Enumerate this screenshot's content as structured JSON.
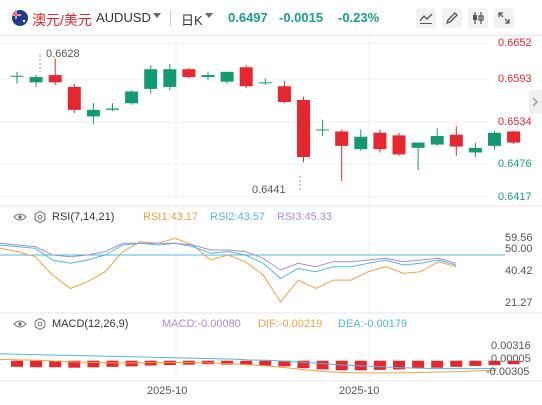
{
  "header": {
    "symbol_name": "澳元/美元",
    "symbol_code": "AUDUSD",
    "period": "日K",
    "last_price": "0.6497",
    "change": "-0.0015",
    "change_pct": "-0.23%",
    "tools": [
      "line-tool-icon",
      "pencil-icon",
      "compare-icon",
      "fullscreen-icon"
    ]
  },
  "main_chart": {
    "price_axis": [
      "0.6652",
      "0.6593",
      "0.6534",
      "0.6476",
      "0.6417"
    ],
    "high_label": "0.6628",
    "low_label": "0.6441",
    "colors": {
      "up": "#139a72",
      "down": "#e8262d"
    }
  },
  "rsi": {
    "title": "RSI(7,14,21)",
    "rsi1": "RSI1:43.17",
    "rsi2": "RSI2:43.57",
    "rsi3": "RSI3:45.33",
    "axis": [
      "59.56",
      "50.00",
      "40.42",
      "21.27"
    ],
    "colors": {
      "rsi1": "#f0a040",
      "rsi2": "#4fb8e0",
      "rsi3": "#a78bdb"
    }
  },
  "macd": {
    "title": "MACD(12,26,9)",
    "macd": "MACD:-0.00080",
    "dif": "DIF:-0.00219",
    "dea": "DEA:-0.00179",
    "axis": [
      "0.00316",
      "0.00005",
      "-0.00305"
    ],
    "colors": {
      "macd": "#a78bdb",
      "dif": "#f0a040",
      "dea": "#4fb8e0"
    }
  },
  "time_axis": [
    "2025-10",
    "2025-10"
  ],
  "chart_data": [
    {
      "type": "candlestick",
      "title": "AUDUSD 日K",
      "ylim": [
        0.6417,
        0.6652
      ],
      "candles": [
        {
          "o": 0.6601,
          "h": 0.6608,
          "l": 0.659,
          "c": 0.6602
        },
        {
          "o": 0.6592,
          "h": 0.6604,
          "l": 0.6585,
          "c": 0.66
        },
        {
          "o": 0.6603,
          "h": 0.6628,
          "l": 0.6588,
          "c": 0.6592
        },
        {
          "o": 0.6585,
          "h": 0.659,
          "l": 0.6545,
          "c": 0.655
        },
        {
          "o": 0.654,
          "h": 0.656,
          "l": 0.6528,
          "c": 0.655
        },
        {
          "o": 0.655,
          "h": 0.656,
          "l": 0.6548,
          "c": 0.6552
        },
        {
          "o": 0.656,
          "h": 0.658,
          "l": 0.6558,
          "c": 0.6578
        },
        {
          "o": 0.6582,
          "h": 0.6618,
          "l": 0.6575,
          "c": 0.6612
        },
        {
          "o": 0.6585,
          "h": 0.662,
          "l": 0.658,
          "c": 0.6612
        },
        {
          "o": 0.6612,
          "h": 0.6614,
          "l": 0.6598,
          "c": 0.66
        },
        {
          "o": 0.66,
          "h": 0.6608,
          "l": 0.6595,
          "c": 0.6603
        },
        {
          "o": 0.6593,
          "h": 0.6605,
          "l": 0.659,
          "c": 0.6608
        },
        {
          "o": 0.6615,
          "h": 0.6618,
          "l": 0.6583,
          "c": 0.6586
        },
        {
          "o": 0.6591,
          "h": 0.6598,
          "l": 0.6588,
          "c": 0.6592
        },
        {
          "o": 0.6586,
          "h": 0.6594,
          "l": 0.656,
          "c": 0.6562
        },
        {
          "o": 0.6565,
          "h": 0.657,
          "l": 0.647,
          "c": 0.6478
        },
        {
          "o": 0.652,
          "h": 0.6535,
          "l": 0.651,
          "c": 0.652
        },
        {
          "o": 0.6517,
          "h": 0.652,
          "l": 0.6441,
          "c": 0.6495
        },
        {
          "o": 0.649,
          "h": 0.652,
          "l": 0.6488,
          "c": 0.6509
        },
        {
          "o": 0.6515,
          "h": 0.652,
          "l": 0.6485,
          "c": 0.649
        },
        {
          "o": 0.6511,
          "h": 0.6515,
          "l": 0.648,
          "c": 0.6482
        },
        {
          "o": 0.6492,
          "h": 0.65,
          "l": 0.6458,
          "c": 0.65
        },
        {
          "o": 0.6497,
          "h": 0.6522,
          "l": 0.6495,
          "c": 0.651
        },
        {
          "o": 0.6512,
          "h": 0.6525,
          "l": 0.648,
          "c": 0.6494
        },
        {
          "o": 0.6485,
          "h": 0.65,
          "l": 0.6478,
          "c": 0.6492
        },
        {
          "o": 0.6495,
          "h": 0.6518,
          "l": 0.649,
          "c": 0.6515
        },
        {
          "o": 0.6517,
          "h": 0.6518,
          "l": 0.6498,
          "c": 0.65
        }
      ]
    },
    {
      "type": "line",
      "title": "RSI(7,14,21)",
      "ylim": [
        21.27,
        59.56
      ],
      "series": [
        {
          "name": "RSI1",
          "values": [
            54,
            52,
            49,
            38,
            30,
            34,
            40,
            52,
            58,
            57,
            60,
            56,
            47,
            50,
            46,
            38,
            22,
            35,
            30,
            35,
            35,
            40,
            43,
            39,
            40,
            46,
            43
          ]
        },
        {
          "name": "RSI2",
          "values": [
            56,
            55,
            54,
            47,
            45,
            47,
            50,
            56,
            57,
            56,
            57,
            55,
            51,
            52,
            50,
            45,
            36,
            42,
            40,
            43,
            43,
            45,
            47,
            44,
            45,
            47,
            44
          ]
        },
        {
          "name": "RSI3",
          "values": [
            57,
            56,
            55,
            50,
            49,
            50,
            52,
            57,
            57,
            57,
            57,
            56,
            53,
            53,
            52,
            48,
            41,
            45,
            43,
            46,
            46,
            47,
            48,
            46,
            47,
            48,
            45
          ]
        }
      ]
    },
    {
      "type": "bar",
      "title": "MACD(12,26,9)",
      "ylim": [
        -0.00305,
        0.00316
      ],
      "series": [
        {
          "name": "MACD",
          "values": [
            -0.0014,
            -0.0015,
            -0.0015,
            -0.0016,
            -0.0015,
            -0.0014,
            -0.0013,
            -0.0011,
            -0.001,
            -0.0009,
            -0.0008,
            -0.0009,
            -0.001,
            -0.0011,
            -0.0013,
            -0.0017,
            -0.002,
            -0.0022,
            -0.0022,
            -0.0021,
            -0.002,
            -0.0018,
            -0.0016,
            -0.0014,
            -0.0012,
            -0.001,
            -0.0008
          ]
        },
        {
          "name": "DIF",
          "values": [
            0.0003,
            0.0002,
            0.0001,
            -0.0001,
            -0.0003,
            -0.0004,
            -0.0005,
            -0.0005,
            -0.0004,
            -0.0004,
            -0.0004,
            -0.0005,
            -0.0007,
            -0.0009,
            -0.0012,
            -0.0016,
            -0.0021,
            -0.0025,
            -0.0027,
            -0.0028,
            -0.0028,
            -0.0028,
            -0.0027,
            -0.0026,
            -0.0025,
            -0.0023,
            -0.0022
          ]
        },
        {
          "name": "DEA",
          "values": [
            0.0016,
            0.0015,
            0.0014,
            0.0013,
            0.0012,
            0.0011,
            0.001,
            0.0009,
            0.0008,
            0.0007,
            0.0006,
            0.0005,
            0.0004,
            0.0002,
            0.0001,
            -0.0001,
            -0.0004,
            -0.0007,
            -0.001,
            -0.0012,
            -0.0014,
            -0.0016,
            -0.0017,
            -0.0018,
            -0.0018,
            -0.0018,
            -0.0018
          ]
        }
      ]
    }
  ]
}
